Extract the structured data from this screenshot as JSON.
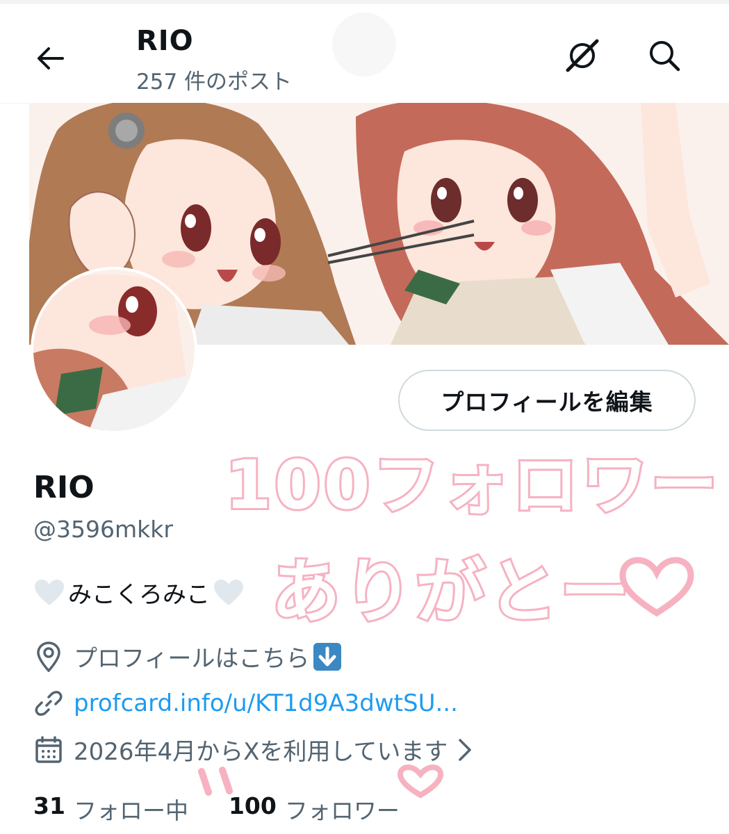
{
  "header": {
    "title": "RIO",
    "post_count": "257 件のポスト"
  },
  "actions": {
    "edit_profile": "プロフィールを編集"
  },
  "profile": {
    "display_name": "RIO",
    "handle": "@3596mkkr",
    "bio": "みこくろみこ",
    "location": "プロフィールはこちら",
    "link": "profcard.info/u/KT1d9A3dwtSU...",
    "joined": "2026年4月からXを利用しています"
  },
  "stats": {
    "following_count": "31",
    "following_label": "フォロー中",
    "followers_count": "100",
    "followers_label": "フォロワー"
  },
  "overlay": {
    "line1": "100フォロワー",
    "line2": "ありがとー"
  },
  "icons": [
    "back-arrow-icon",
    "grok-icon",
    "search-icon",
    "location-pin-icon",
    "link-icon",
    "calendar-icon",
    "chevron-right-icon",
    "heart-icon",
    "down-arrow-emoji-icon"
  ],
  "colors": {
    "accent": "#1d9bf0",
    "secondary_text": "#536471",
    "overlay_pink": "#f6b2c1",
    "border": "#cfd9de"
  }
}
